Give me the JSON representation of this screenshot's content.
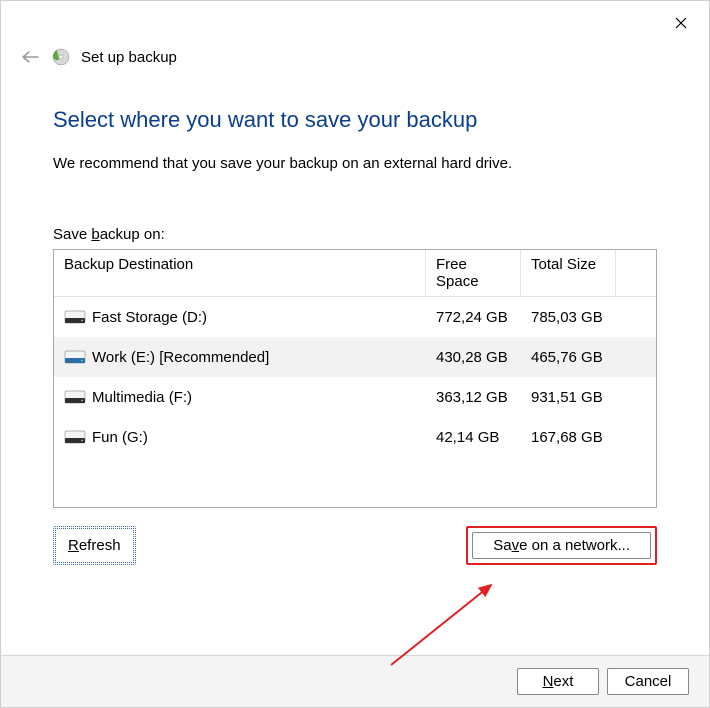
{
  "titlebar": {
    "close_tooltip": "Close"
  },
  "header": {
    "wizard_title": "Set up backup"
  },
  "main": {
    "heading": "Select where you want to save your backup",
    "description": "We recommend that you save your backup on an external hard drive.",
    "save_label_pre": "Save ",
    "save_label_u": "b",
    "save_label_post": "ackup on:",
    "columns": {
      "dest": "Backup Destination",
      "free": "Free Space",
      "total": "Total Size"
    },
    "drives": [
      {
        "name": "Fast Storage (D:)",
        "free": "772,24 GB",
        "total": "785,03 GB",
        "selected": false,
        "color": "#2e2e2e"
      },
      {
        "name": "Work (E:) [Recommended]",
        "free": "430,28 GB",
        "total": "465,76 GB",
        "selected": true,
        "color": "#2b6fa8"
      },
      {
        "name": "Multimedia (F:)",
        "free": "363,12 GB",
        "total": "931,51 GB",
        "selected": false,
        "color": "#2e2e2e"
      },
      {
        "name": "Fun (G:)",
        "free": "42,14 GB",
        "total": "167,68 GB",
        "selected": false,
        "color": "#2e2e2e"
      }
    ],
    "refresh_u": "R",
    "refresh_post": "efresh",
    "network_pre": "Sa",
    "network_u": "v",
    "network_post": "e on a network..."
  },
  "footer": {
    "next_u": "N",
    "next_post": "ext",
    "cancel": "Cancel"
  }
}
